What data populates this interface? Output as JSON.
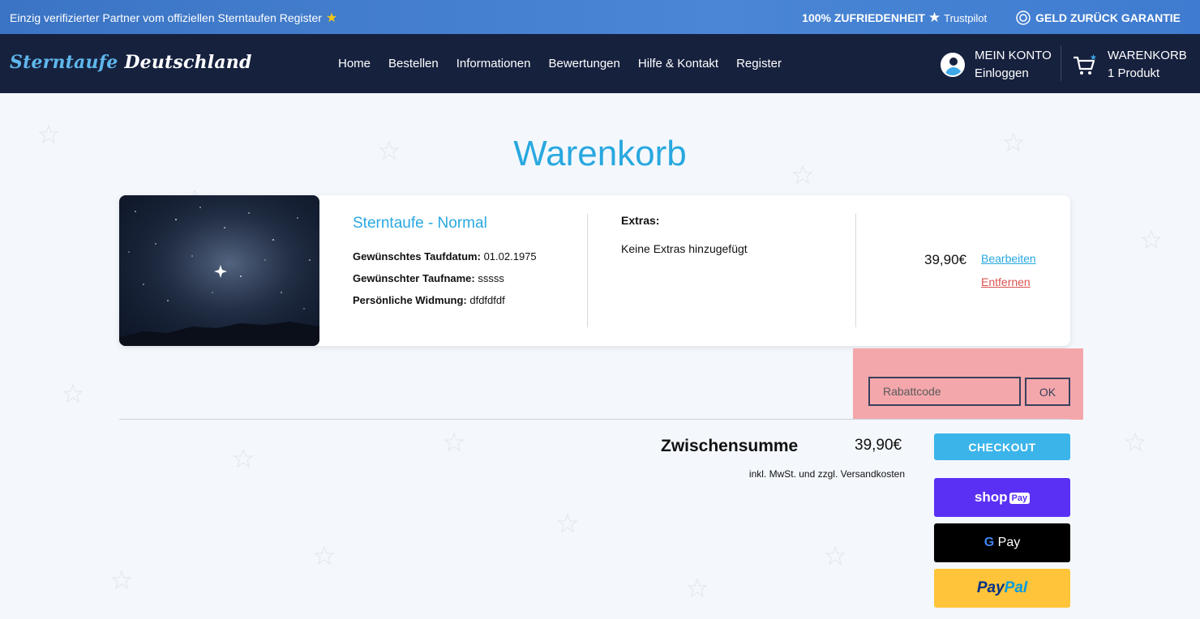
{
  "topbar": {
    "left_text": "Einzig verifizierter Partner vom offiziellen Sterntaufen Register",
    "satisfaction": "100% ZUFRIEDENHEIT",
    "trustpilot": "Trustpilot",
    "guarantee": "GELD ZURÜCK GARANTIE"
  },
  "header": {
    "logo_part1": "Sterntaufe",
    "logo_part2": "Deutschland",
    "nav": [
      "Home",
      "Bestellen",
      "Informationen",
      "Bewertungen",
      "Hilfe & Kontakt",
      "Register"
    ],
    "account_title": "MEIN KONTO",
    "account_sub": "Einloggen",
    "cart_title": "WARENKORB",
    "cart_sub": "1 Produkt"
  },
  "page": {
    "title": "Warenkorb"
  },
  "cart_item": {
    "name": "Sterntaufe - Normal",
    "date_label": "Gewünschtes Taufdatum:",
    "date_value": "01.02.1975",
    "name_label": "Gewünschter Taufname:",
    "name_value": "sssss",
    "dedication_label": "Persönliche Widmung:",
    "dedication_value": "dfdfdfdf",
    "extras_label": "Extras:",
    "extras_value": "Keine Extras hinzugefügt",
    "price": "39,90€",
    "edit_label": "Bearbeiten",
    "remove_label": "Entfernen"
  },
  "coupon": {
    "placeholder": "Rabattcode",
    "ok_label": "OK"
  },
  "summary": {
    "subtotal_label": "Zwischensumme",
    "subtotal_value": "39,90€",
    "tax_note": "inkl. MwSt. und zzgl. Versandkosten"
  },
  "buttons": {
    "checkout": "CHECKOUT",
    "shop_pay_1": "shop",
    "shop_pay_2": "Pay",
    "gpay_g": "G",
    "gpay_text": "Pay",
    "paypal_1": "Pay",
    "paypal_2": "Pal"
  },
  "colors": {
    "accent": "#29a8e0",
    "header_bg": "#16213e",
    "topbar_bg": "#3b74c4",
    "remove": "#d9534f",
    "coupon_highlight": "#f4a7ab"
  }
}
